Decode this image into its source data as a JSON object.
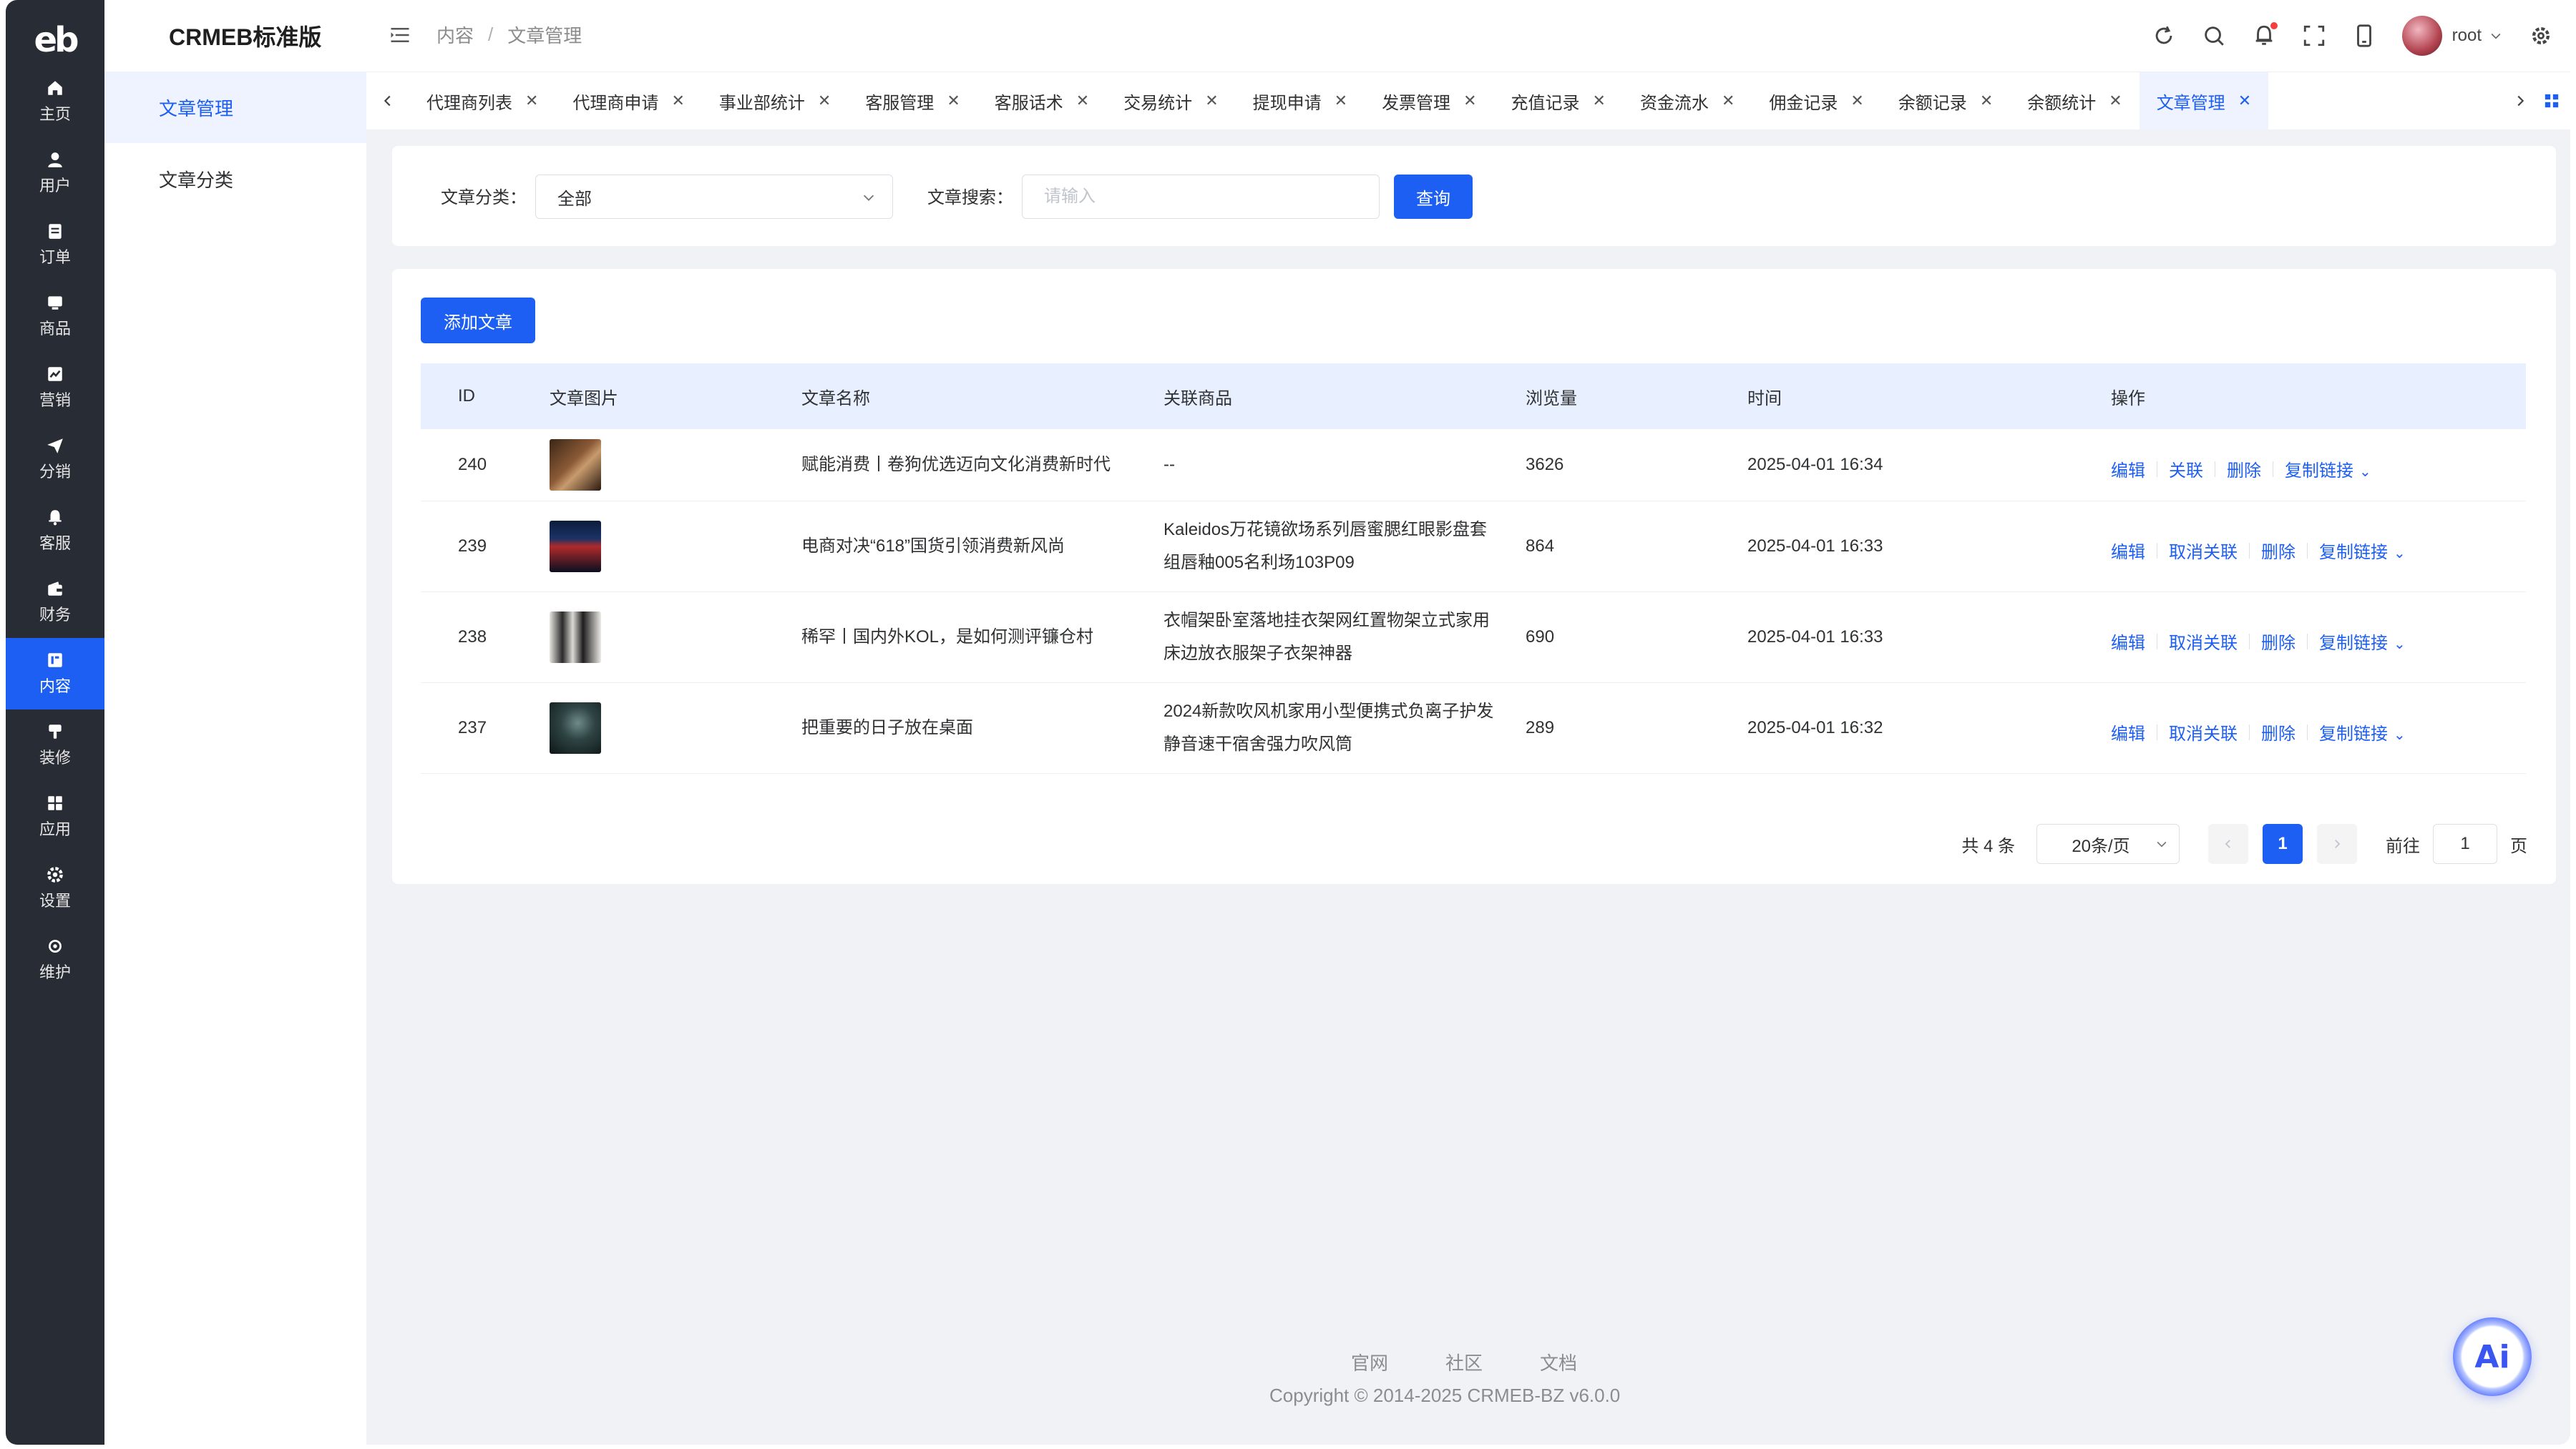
{
  "rail": {
    "logo": "eb",
    "items": [
      {
        "label": "主页",
        "icon": "home-icon"
      },
      {
        "label": "用户",
        "icon": "user-icon"
      },
      {
        "label": "订单",
        "icon": "order-icon"
      },
      {
        "label": "商品",
        "icon": "product-icon"
      },
      {
        "label": "营销",
        "icon": "marketing-icon"
      },
      {
        "label": "分销",
        "icon": "distribution-icon"
      },
      {
        "label": "客服",
        "icon": "bell-icon"
      },
      {
        "label": "财务",
        "icon": "wallet-icon"
      },
      {
        "label": "内容",
        "icon": "content-icon"
      },
      {
        "label": "装修",
        "icon": "brush-icon"
      },
      {
        "label": "应用",
        "icon": "apps-icon"
      },
      {
        "label": "设置",
        "icon": "gear-icon"
      },
      {
        "label": "维护",
        "icon": "maintain-icon"
      }
    ],
    "active": "内容"
  },
  "submenu": {
    "brand": "CRMEB标准版",
    "items": [
      {
        "label": "文章管理"
      },
      {
        "label": "文章分类"
      }
    ]
  },
  "header": {
    "breadcrumb": [
      "内容",
      "文章管理"
    ],
    "username": "root"
  },
  "tabs": [
    "代理商列表",
    "代理商申请",
    "事业部统计",
    "客服管理",
    "客服话术",
    "交易统计",
    "提现申请",
    "发票管理",
    "充值记录",
    "资金流水",
    "佣金记录",
    "余额记录",
    "余额统计",
    "文章管理"
  ],
  "filter": {
    "category_label": "文章分类：",
    "category_value": "全部",
    "search_label": "文章搜索：",
    "search_placeholder": "请输入",
    "query_button": "查询"
  },
  "toolbar": {
    "add_button": "添加文章"
  },
  "table": {
    "columns": [
      "ID",
      "文章图片",
      "文章名称",
      "关联商品",
      "浏览量",
      "时间",
      "操作"
    ],
    "rows": [
      {
        "id": "240",
        "name": "赋能消费丨卷狗优选迈向文化消费新时代",
        "product_line1": "--",
        "product_line2": "",
        "views": "3626",
        "time": "2025-04-01 16:34",
        "ops": [
          "编辑",
          "关联",
          "删除",
          "复制链接"
        ]
      },
      {
        "id": "239",
        "name": "电商对决“618”国货引领消费新风尚",
        "product_line1": "Kaleidos万花镜欲场系列唇蜜腮红眼影盘套",
        "product_line2": "组唇釉005名利场103P09",
        "views": "864",
        "time": "2025-04-01 16:33",
        "ops": [
          "编辑",
          "取消关联",
          "删除",
          "复制链接"
        ]
      },
      {
        "id": "238",
        "name": "稀罕丨国内外KOL，是如何测评镰仓村",
        "product_line1": "衣帽架卧室落地挂衣架网红置物架立式家用",
        "product_line2": "床边放衣服架子衣架神器",
        "views": "690",
        "time": "2025-04-01 16:33",
        "ops": [
          "编辑",
          "取消关联",
          "删除",
          "复制链接"
        ]
      },
      {
        "id": "237",
        "name": "把重要的日子放在桌面",
        "product_line1": "2024新款吹风机家用小型便携式负离子护发",
        "product_line2": "静音速干宿舍强力吹风筒",
        "views": "289",
        "time": "2025-04-01 16:32",
        "ops": [
          "编辑",
          "取消关联",
          "删除",
          "复制链接"
        ]
      }
    ]
  },
  "pagination": {
    "total": "共 4 条",
    "page_size": "20条/页",
    "current": "1",
    "goto_label": "前往",
    "goto_value": "1",
    "goto_suffix": "页"
  },
  "footer": {
    "links": [
      "官网",
      "社区",
      "文档"
    ],
    "copyright": "Copyright © 2014-2025 CRMEB-BZ v6.0.0"
  },
  "ai_button": "Ai",
  "colors": {
    "primary": "#1d5ff2",
    "rail_bg": "#282c34",
    "header_row_bg": "#e8efff",
    "page_bg": "#f0f2f5"
  }
}
